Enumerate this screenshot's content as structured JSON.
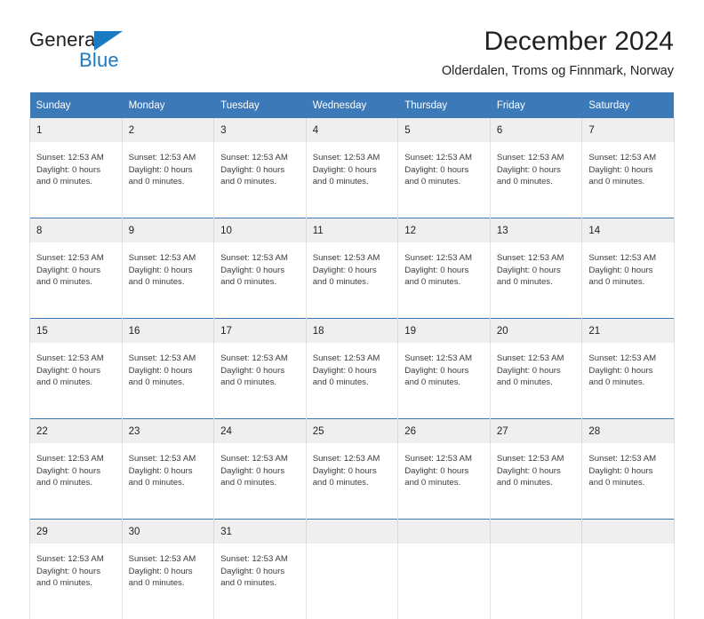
{
  "brand": {
    "name_part1": "General",
    "name_part2": "Blue",
    "triangle_color": "#1b7ac4",
    "text_color": "#231f20"
  },
  "header": {
    "month_title": "December 2024",
    "location": "Olderdalen, Troms og Finnmark, Norway"
  },
  "theme": {
    "header_blue": "#3b79b8",
    "daynum_background": "#efefef",
    "cell_background": "#ffffff",
    "separator_blue": "#3b79b8"
  },
  "calendar": {
    "weekday_headers": [
      "Sunday",
      "Monday",
      "Tuesday",
      "Wednesday",
      "Thursday",
      "Friday",
      "Saturday"
    ],
    "weeks": [
      {
        "days": [
          {
            "num": "1",
            "l1": "Sunset: 12:53 AM",
            "l2": "Daylight: 0 hours",
            "l3": "and 0 minutes."
          },
          {
            "num": "2",
            "l1": "Sunset: 12:53 AM",
            "l2": "Daylight: 0 hours",
            "l3": "and 0 minutes."
          },
          {
            "num": "3",
            "l1": "Sunset: 12:53 AM",
            "l2": "Daylight: 0 hours",
            "l3": "and 0 minutes."
          },
          {
            "num": "4",
            "l1": "Sunset: 12:53 AM",
            "l2": "Daylight: 0 hours",
            "l3": "and 0 minutes."
          },
          {
            "num": "5",
            "l1": "Sunset: 12:53 AM",
            "l2": "Daylight: 0 hours",
            "l3": "and 0 minutes."
          },
          {
            "num": "6",
            "l1": "Sunset: 12:53 AM",
            "l2": "Daylight: 0 hours",
            "l3": "and 0 minutes."
          },
          {
            "num": "7",
            "l1": "Sunset: 12:53 AM",
            "l2": "Daylight: 0 hours",
            "l3": "and 0 minutes."
          }
        ]
      },
      {
        "days": [
          {
            "num": "8",
            "l1": "Sunset: 12:53 AM",
            "l2": "Daylight: 0 hours",
            "l3": "and 0 minutes."
          },
          {
            "num": "9",
            "l1": "Sunset: 12:53 AM",
            "l2": "Daylight: 0 hours",
            "l3": "and 0 minutes."
          },
          {
            "num": "10",
            "l1": "Sunset: 12:53 AM",
            "l2": "Daylight: 0 hours",
            "l3": "and 0 minutes."
          },
          {
            "num": "11",
            "l1": "Sunset: 12:53 AM",
            "l2": "Daylight: 0 hours",
            "l3": "and 0 minutes."
          },
          {
            "num": "12",
            "l1": "Sunset: 12:53 AM",
            "l2": "Daylight: 0 hours",
            "l3": "and 0 minutes."
          },
          {
            "num": "13",
            "l1": "Sunset: 12:53 AM",
            "l2": "Daylight: 0 hours",
            "l3": "and 0 minutes."
          },
          {
            "num": "14",
            "l1": "Sunset: 12:53 AM",
            "l2": "Daylight: 0 hours",
            "l3": "and 0 minutes."
          }
        ]
      },
      {
        "days": [
          {
            "num": "15",
            "l1": "Sunset: 12:53 AM",
            "l2": "Daylight: 0 hours",
            "l3": "and 0 minutes."
          },
          {
            "num": "16",
            "l1": "Sunset: 12:53 AM",
            "l2": "Daylight: 0 hours",
            "l3": "and 0 minutes."
          },
          {
            "num": "17",
            "l1": "Sunset: 12:53 AM",
            "l2": "Daylight: 0 hours",
            "l3": "and 0 minutes."
          },
          {
            "num": "18",
            "l1": "Sunset: 12:53 AM",
            "l2": "Daylight: 0 hours",
            "l3": "and 0 minutes."
          },
          {
            "num": "19",
            "l1": "Sunset: 12:53 AM",
            "l2": "Daylight: 0 hours",
            "l3": "and 0 minutes."
          },
          {
            "num": "20",
            "l1": "Sunset: 12:53 AM",
            "l2": "Daylight: 0 hours",
            "l3": "and 0 minutes."
          },
          {
            "num": "21",
            "l1": "Sunset: 12:53 AM",
            "l2": "Daylight: 0 hours",
            "l3": "and 0 minutes."
          }
        ]
      },
      {
        "days": [
          {
            "num": "22",
            "l1": "Sunset: 12:53 AM",
            "l2": "Daylight: 0 hours",
            "l3": "and 0 minutes."
          },
          {
            "num": "23",
            "l1": "Sunset: 12:53 AM",
            "l2": "Daylight: 0 hours",
            "l3": "and 0 minutes."
          },
          {
            "num": "24",
            "l1": "Sunset: 12:53 AM",
            "l2": "Daylight: 0 hours",
            "l3": "and 0 minutes."
          },
          {
            "num": "25",
            "l1": "Sunset: 12:53 AM",
            "l2": "Daylight: 0 hours",
            "l3": "and 0 minutes."
          },
          {
            "num": "26",
            "l1": "Sunset: 12:53 AM",
            "l2": "Daylight: 0 hours",
            "l3": "and 0 minutes."
          },
          {
            "num": "27",
            "l1": "Sunset: 12:53 AM",
            "l2": "Daylight: 0 hours",
            "l3": "and 0 minutes."
          },
          {
            "num": "28",
            "l1": "Sunset: 12:53 AM",
            "l2": "Daylight: 0 hours",
            "l3": "and 0 minutes."
          }
        ]
      },
      {
        "days": [
          {
            "num": "29",
            "l1": "Sunset: 12:53 AM",
            "l2": "Daylight: 0 hours",
            "l3": "and 0 minutes."
          },
          {
            "num": "30",
            "l1": "Sunset: 12:53 AM",
            "l2": "Daylight: 0 hours",
            "l3": "and 0 minutes."
          },
          {
            "num": "31",
            "l1": "Sunset: 12:53 AM",
            "l2": "Daylight: 0 hours",
            "l3": "and 0 minutes."
          },
          {
            "num": "",
            "l1": "",
            "l2": "",
            "l3": ""
          },
          {
            "num": "",
            "l1": "",
            "l2": "",
            "l3": ""
          },
          {
            "num": "",
            "l1": "",
            "l2": "",
            "l3": ""
          },
          {
            "num": "",
            "l1": "",
            "l2": "",
            "l3": ""
          }
        ]
      }
    ]
  }
}
